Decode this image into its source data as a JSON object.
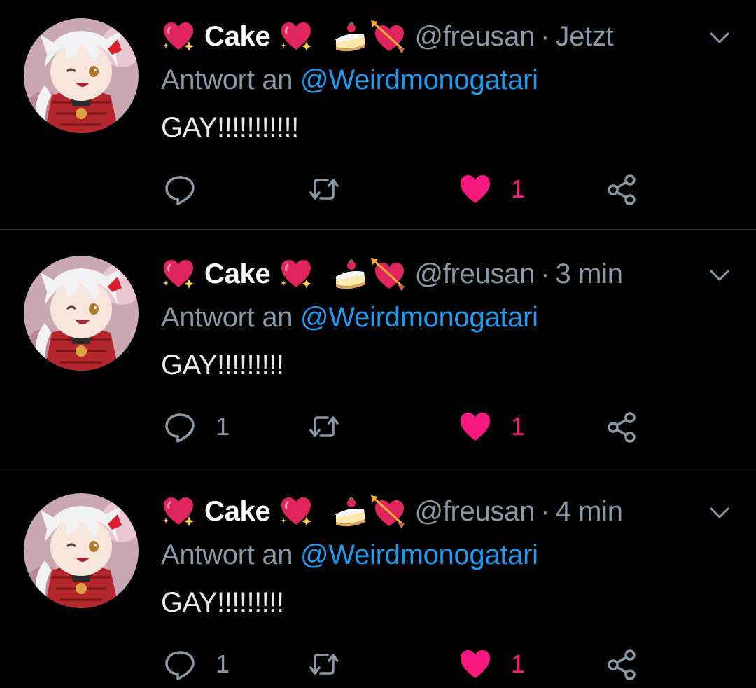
{
  "colors": {
    "background": "#000000",
    "name": "#ffffff",
    "muted": "#8b98a5",
    "mention": "#1d9bf0",
    "like": "#f91880",
    "divider": "#2f3336"
  },
  "tweets": [
    {
      "display_name": "Cake",
      "handle": "@freusan",
      "separator": "·",
      "time": "Jetzt",
      "reply_prefix": "Antwort an",
      "reply_to": "@Weirdmonogatari",
      "text": "GAY!!!!!!!!!!!",
      "reply_count": "",
      "retweet_count": "",
      "like_count": "1",
      "liked": true
    },
    {
      "display_name": "Cake",
      "handle": "@freusan",
      "separator": "·",
      "time": "3 min",
      "reply_prefix": "Antwort an",
      "reply_to": "@Weirdmonogatari",
      "text": "GAY!!!!!!!!!",
      "reply_count": "1",
      "retweet_count": "",
      "like_count": "1",
      "liked": true
    },
    {
      "display_name": "Cake",
      "handle": "@freusan",
      "separator": "·",
      "time": "4 min",
      "reply_prefix": "Antwort an",
      "reply_to": "@Weirdmonogatari",
      "text": "GAY!!!!!!!!!",
      "reply_count": "1",
      "retweet_count": "",
      "like_count": "1",
      "liked": true
    }
  ],
  "icons": {
    "name_emoji_left": "sparkling-heart-icon",
    "name_emoji_right": "sparkling-heart-icon",
    "name_emoji_cake": "shortcake-icon",
    "name_emoji_arrow": "heart-with-arrow-icon",
    "menu": "chevron-down-icon",
    "reply": "reply-icon",
    "retweet": "retweet-icon",
    "like": "heart-icon",
    "share": "share-icon"
  }
}
